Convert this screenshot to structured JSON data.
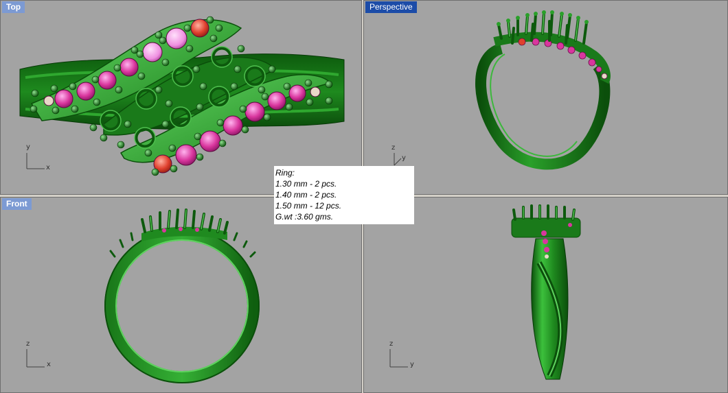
{
  "viewports": {
    "top": {
      "title": "Top",
      "axes": [
        "x",
        "y"
      ]
    },
    "perspective": {
      "title": "Perspective",
      "active": true,
      "axes": [
        "y",
        "z"
      ]
    },
    "front": {
      "title": "Front",
      "axes": [
        "x",
        "z"
      ]
    },
    "right": {
      "axes": [
        "y",
        "z"
      ]
    }
  },
  "note": {
    "lines": [
      "Ring:",
      "1.30 mm - 2 pcs.",
      "1.40 mm - 2 pcs.",
      "1.50 mm - 12 pcs.",
      "G.wt :3.60 gms."
    ]
  },
  "colors": {
    "viewport_bg": "#a3a3a3",
    "metal": "#1f8a1f",
    "metal_light": "#5fd35f",
    "metal_dark": "#0b4f0b",
    "stone_pink": "#d9369e",
    "stone_light_pink": "#ef8fe0",
    "stone_red": "#e0402e",
    "title_active": "#1c4ca8",
    "title_inactive": "#7c9ad3"
  }
}
